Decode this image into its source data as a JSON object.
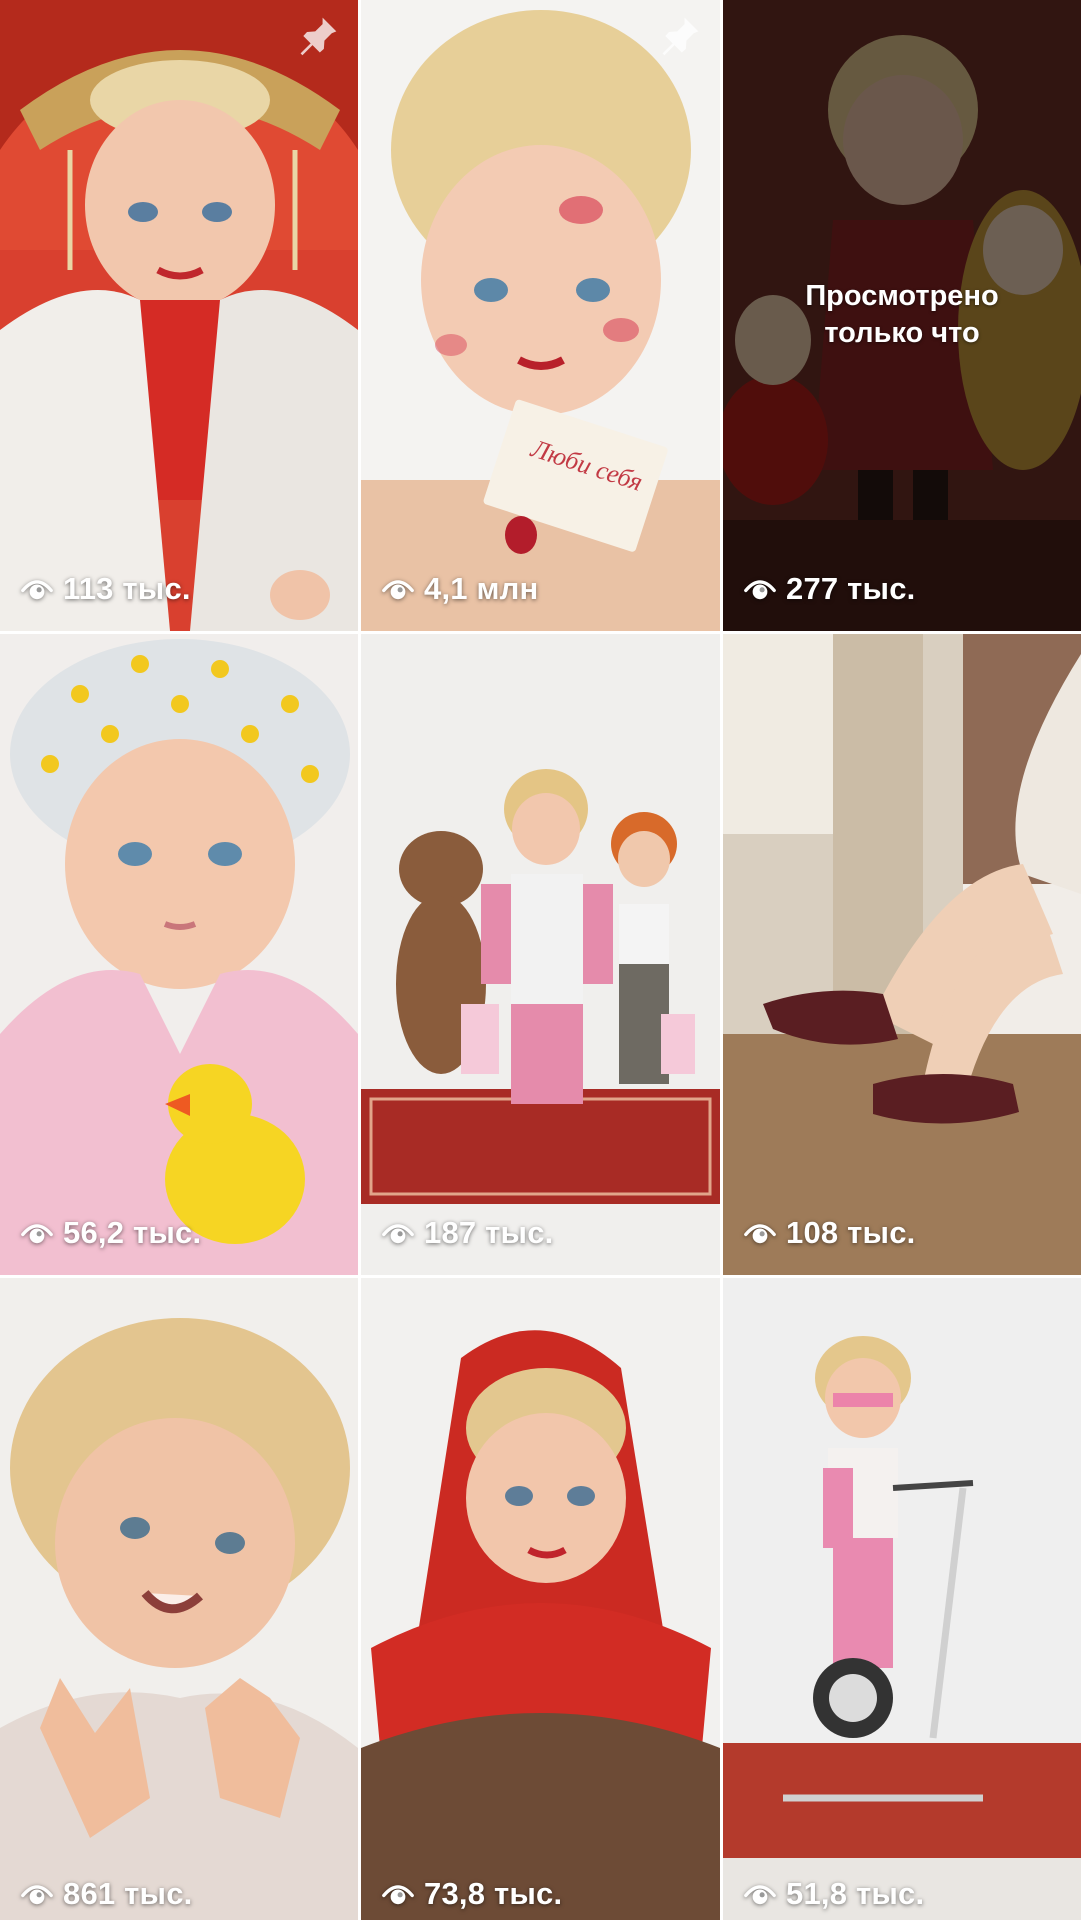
{
  "icons": {
    "views": "eye-icon",
    "pinned": "pin-icon"
  },
  "colors": {
    "overlay_text": "#ffffff",
    "viewed_overlay": "rgba(0,0,0,0.55)"
  },
  "tiles": [
    {
      "views": "113 тыс.",
      "pinned": true,
      "thumbnail": "doll-in-red-kokoshnik-and-white-fur-coat"
    },
    {
      "views": "4,1 млн",
      "pinned": true,
      "thumbnail": "doll-with-lipstick-kisses-holding-note",
      "note_text": "Люби себя"
    },
    {
      "views": "277 тыс.",
      "pinned": false,
      "thumbnail": "doll-in-red-leather-coat-with-matryoshka",
      "status": "Просмотрено\nтолько что"
    },
    {
      "views": "56,2 тыс.",
      "pinned": false,
      "thumbnail": "doll-in-shower-cap-with-rubber-duck"
    },
    {
      "views": "187 тыс.",
      "pinned": false,
      "thumbnail": "dolls-and-teddy-bear-on-carpet"
    },
    {
      "views": "108 тыс.",
      "pinned": false,
      "thumbnail": "doll-legs-in-slippers-by-window"
    },
    {
      "views": "861 тыс.",
      "pinned": false,
      "thumbnail": "smiling-curly-doll-hands-on-chest"
    },
    {
      "views": "73,8 тыс.",
      "pinned": false,
      "thumbnail": "doll-in-red-headscarf-and-fur-coat"
    },
    {
      "views": "51,8 тыс.",
      "pinned": false,
      "thumbnail": "doll-on-exercise-bike"
    }
  ]
}
